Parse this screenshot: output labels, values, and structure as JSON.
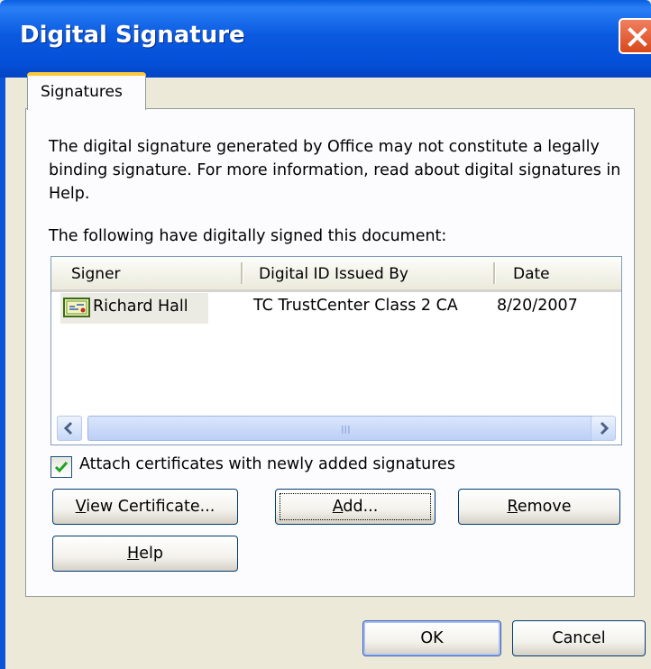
{
  "window": {
    "title": "Digital Signature",
    "close_icon": "close-icon"
  },
  "tabs": [
    {
      "label": "Signatures",
      "selected": true
    }
  ],
  "description": "The digital signature generated by Office may not constitute a legally binding signature. For more information, read about digital signatures in Help.",
  "list_label": "The following have digitally signed this document:",
  "signatures_table": {
    "columns": [
      "Signer",
      "Digital ID Issued By",
      "Date"
    ],
    "rows": [
      {
        "signer": "Richard Hall",
        "issuer": "TC TrustCenter Class 2 CA",
        "date": "8/20/2007",
        "icon": "certificate-icon"
      }
    ],
    "scrollbar_grip": "III"
  },
  "attach_checkbox": {
    "label": "Attach certificates with newly added signatures",
    "checked": true
  },
  "buttons": {
    "view_certificate": {
      "pre": "",
      "accel": "V",
      "post": "iew Certificate..."
    },
    "add": {
      "pre": "",
      "accel": "A",
      "post": "dd..."
    },
    "remove": {
      "pre": "",
      "accel": "R",
      "post": "emove"
    },
    "help": {
      "pre": "",
      "accel": "H",
      "post": "elp"
    },
    "ok": "OK",
    "cancel": "Cancel"
  },
  "colors": {
    "titlebar": "#0a5ae0",
    "dialog_bg": "#ece9d8",
    "tab_accent": "#ffc83c",
    "check": "#21a121"
  }
}
